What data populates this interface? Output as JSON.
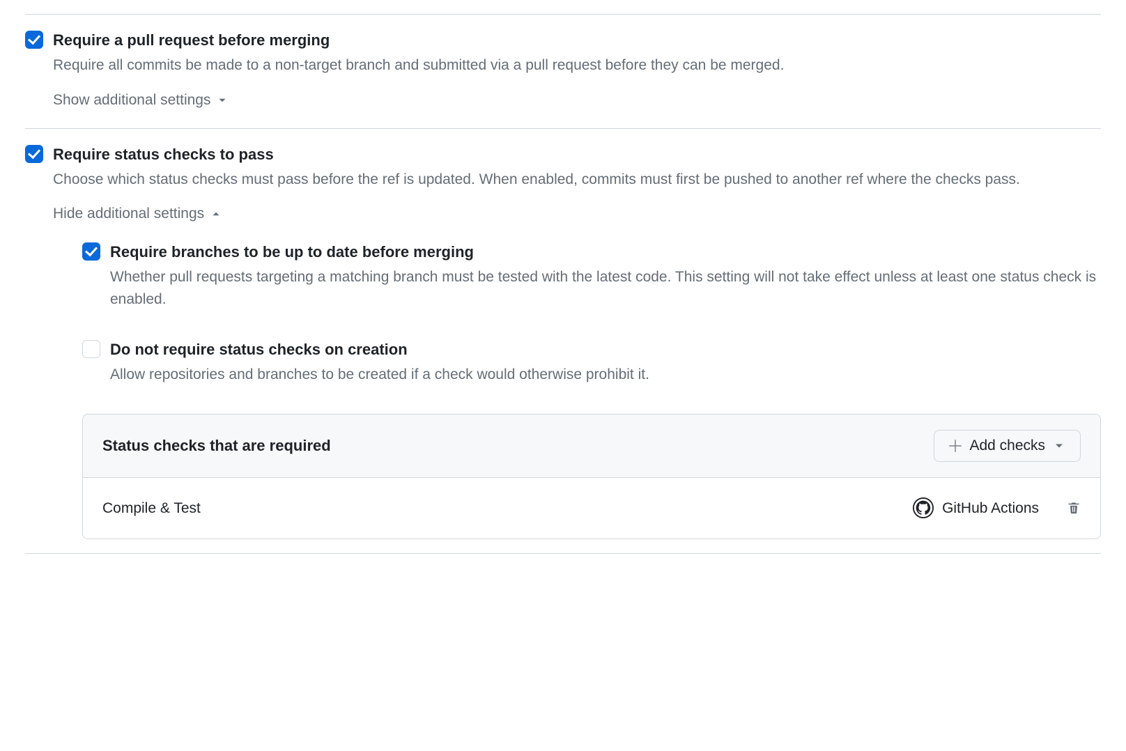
{
  "rules": {
    "require_pr": {
      "checked": true,
      "title": "Require a pull request before merging",
      "desc": "Require all commits be made to a non-target branch and submitted via a pull request before they can be merged.",
      "toggle_label": "Show additional settings"
    },
    "require_checks": {
      "checked": true,
      "title": "Require status checks to pass",
      "desc": "Choose which status checks must pass before the ref is updated. When enabled, commits must first be pushed to another ref where the checks pass.",
      "toggle_label": "Hide additional settings",
      "sub": {
        "up_to_date": {
          "checked": true,
          "title": "Require branches to be up to date before merging",
          "desc": "Whether pull requests targeting a matching branch must be tested with the latest code. This setting will not take effect unless at least one status check is enabled."
        },
        "skip_on_create": {
          "checked": false,
          "title": "Do not require status checks on creation",
          "desc": "Allow repositories and branches to be created if a check would otherwise prohibit it."
        }
      },
      "panel": {
        "title": "Status checks that are required",
        "add_label": "Add checks",
        "items": [
          {
            "name": "Compile & Test",
            "source": "GitHub Actions"
          }
        ]
      }
    }
  }
}
